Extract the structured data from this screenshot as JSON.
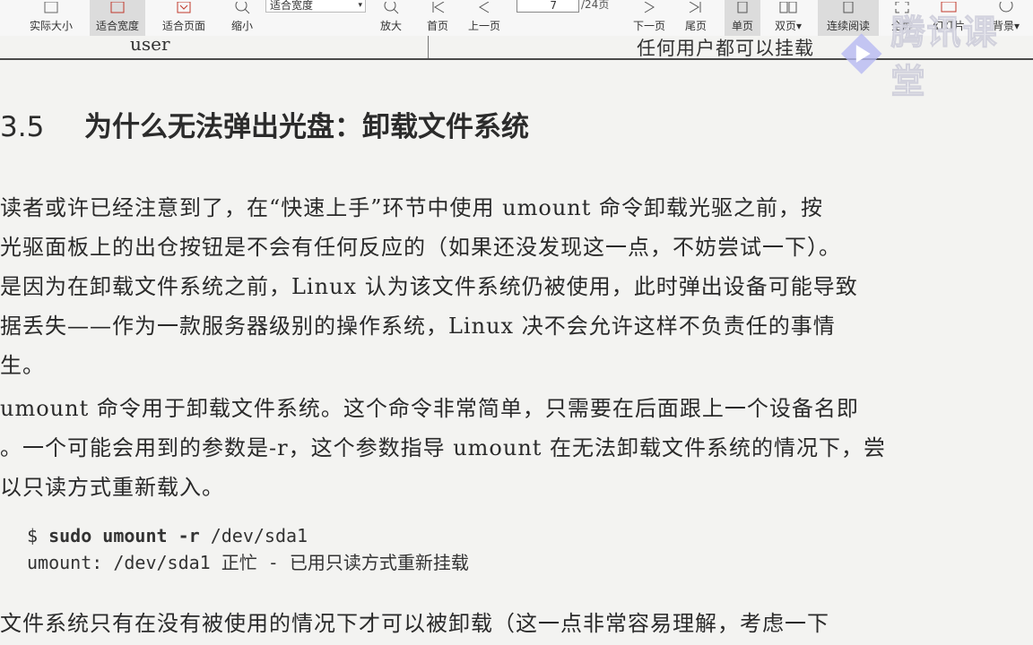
{
  "toolbar": {
    "buttons": [
      {
        "id": "actual",
        "label": "实际大小",
        "icon": "page-icon"
      },
      {
        "id": "fitw",
        "label": "适合宽度",
        "icon": "fit-width-icon",
        "active": true
      },
      {
        "id": "fitp",
        "label": "适合页面",
        "icon": "fit-page-icon"
      },
      {
        "id": "zoomout",
        "label": "缩小",
        "icon": "zoom-out-icon"
      },
      {
        "id": "zoomin",
        "label": "放大",
        "icon": "zoom-in-icon"
      },
      {
        "id": "first",
        "label": "首页",
        "icon": "first-page-icon"
      },
      {
        "id": "prev",
        "label": "上一页",
        "icon": "prev-page-icon"
      },
      {
        "id": "next",
        "label": "下一页",
        "icon": "next-page-icon"
      },
      {
        "id": "last",
        "label": "尾页",
        "icon": "last-page-icon"
      },
      {
        "id": "single",
        "label": "单页",
        "icon": "single-page-icon",
        "active": true
      },
      {
        "id": "double",
        "label": "双页",
        "icon": "double-page-icon",
        "dropdown": true
      },
      {
        "id": "continuous",
        "label": "连续阅读",
        "icon": "continuous-icon",
        "active": true
      },
      {
        "id": "fullscreen",
        "label": "全屏",
        "icon": "fullscreen-icon"
      },
      {
        "id": "slides",
        "label": "幻灯片",
        "icon": "slideshow-icon"
      },
      {
        "id": "bg",
        "label": "背景",
        "icon": "background-icon",
        "dropdown": true
      }
    ],
    "zoom_select_value": "适合宽度",
    "page_number": "7",
    "page_total": "/24页",
    "dropdown_glyph": "▾"
  },
  "document": {
    "prev_table_left": "user",
    "prev_table_right": "任何用户都可以挂载",
    "section_number": "3.5",
    "section_title": "为什么无法弹出光盘：卸载文件系统",
    "para1": [
      "  读者或许已经注意到了，在“快速上手”环节中使用 umount 命令卸载光驱之前，按",
      "光驱面板上的出仓按钮是不会有任何反应的（如果还没发现这一点，不妨尝试一下）。",
      "是因为在卸载文件系统之前，Linux 认为该文件系统仍被使用，此时弹出设备可能导致",
      "据丢失——作为一款服务器级别的操作系统，Linux 决不会允许这样不负责任的事情",
      "生。"
    ],
    "para2": [
      " umount 命令用于卸载文件系统。这个命令非常简单，只需要在后面跟上一个设备名即",
      "。一个可能会用到的参数是-r，这个参数指导 umount 在无法卸载文件系统的情况下，尝",
      "以只读方式重新载入。"
    ],
    "code_prompt": "$ ",
    "code_cmd": "sudo umount -r",
    "code_arg": " /dev/sda1",
    "code_output": "umount: /dev/sda1 正忙 - 已用只读方式重新挂载",
    "para3": "  文件系统只有在没有被使用的情况下才可以被卸载（这一点非常容易理解，考虑一下"
  },
  "watermark": {
    "text": "腾讯课堂"
  }
}
